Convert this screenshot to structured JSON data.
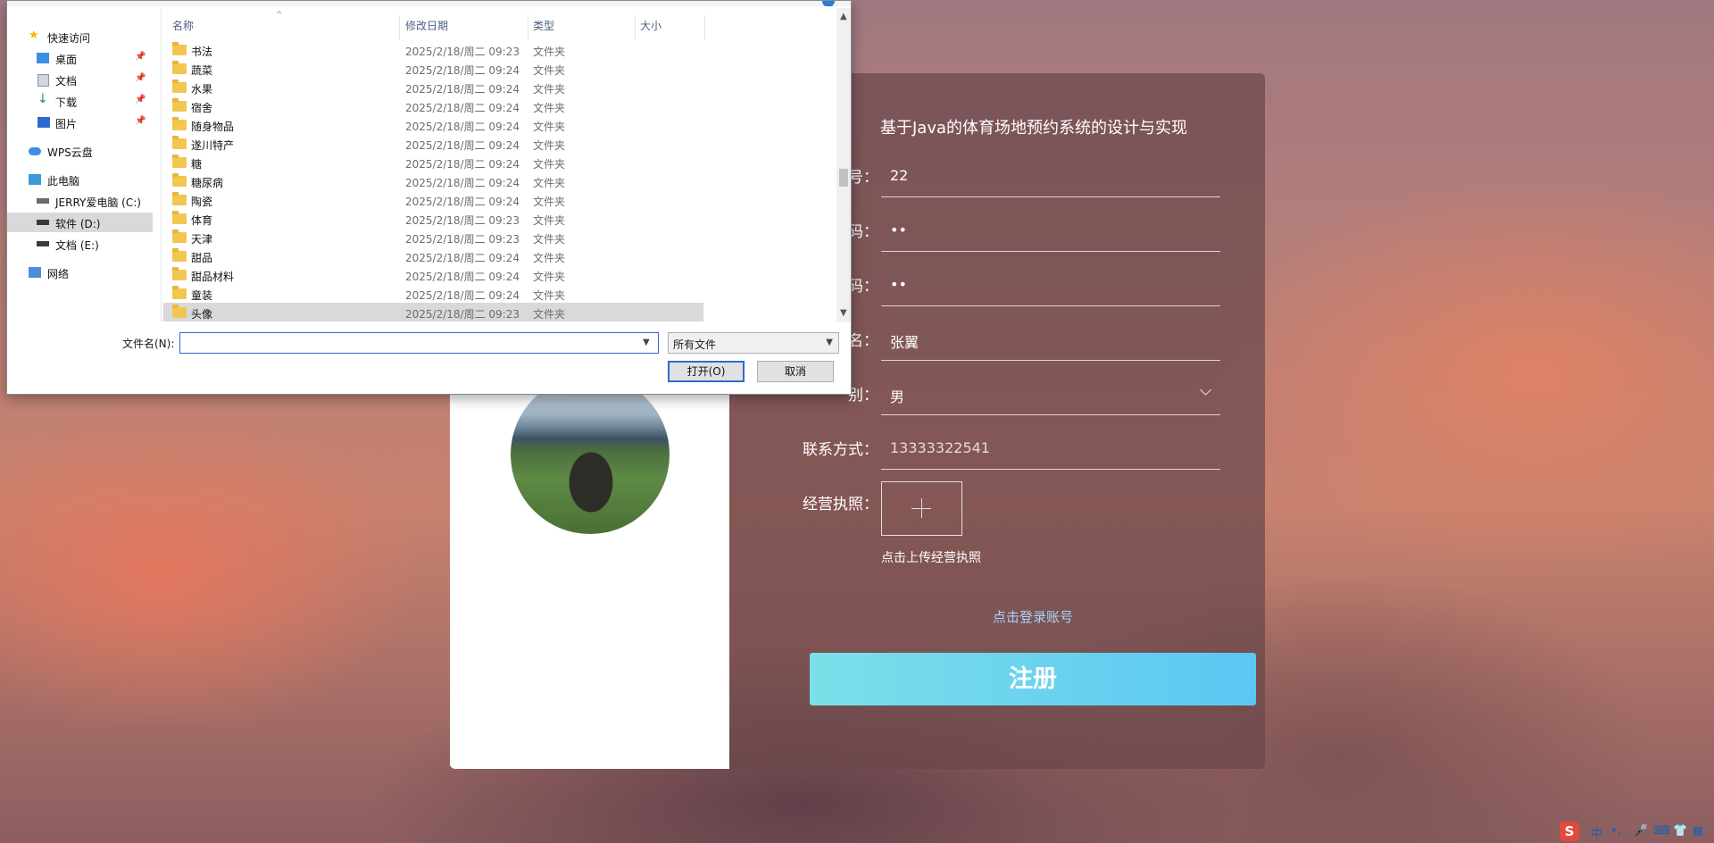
{
  "registration": {
    "title": "基于Java的体育场地预约系统的设计与实现",
    "fields": [
      {
        "label": "号：",
        "value": "22",
        "required": true
      },
      {
        "label": "码：",
        "value": "••",
        "required": true
      },
      {
        "label": "码：",
        "value": "••",
        "required": true
      },
      {
        "label": "名：",
        "value": "张翼",
        "required": true
      },
      {
        "label": "别：",
        "value": "男",
        "required": false
      },
      {
        "label": "联系方式：",
        "value": "13333322541",
        "required": false
      }
    ],
    "license_label": "经营执照：",
    "upload_hint": "点击上传经营执照",
    "login_link": "点击登录账号",
    "register_button": "注册"
  },
  "dialog": {
    "nav": [
      {
        "label": "快速访问",
        "icon": "star-icon"
      },
      {
        "label": "桌面",
        "icon": "desktop-icon",
        "pinned": true
      },
      {
        "label": "文档",
        "icon": "document-icon",
        "pinned": true
      },
      {
        "label": "下载",
        "icon": "download-icon",
        "pinned": true
      },
      {
        "label": "图片",
        "icon": "picture-icon",
        "pinned": true
      },
      {
        "label": "WPS云盘",
        "icon": "cloud-icon"
      },
      {
        "label": "此电脑",
        "icon": "computer-icon"
      },
      {
        "label": "JERRY爱电脑 (C:)",
        "icon": "drive-icon"
      },
      {
        "label": "软件 (D:)",
        "icon": "drive-icon",
        "selected": true
      },
      {
        "label": "文档 (E:)",
        "icon": "drive-icon"
      },
      {
        "label": "网络",
        "icon": "network-icon"
      }
    ],
    "columns": {
      "name": "名称",
      "date": "修改日期",
      "type": "类型",
      "size": "大小"
    },
    "files": [
      {
        "name": "书法",
        "date": "2025/2/18/周二 09:23",
        "type": "文件夹"
      },
      {
        "name": "蔬菜",
        "date": "2025/2/18/周二 09:24",
        "type": "文件夹"
      },
      {
        "name": "水果",
        "date": "2025/2/18/周二 09:24",
        "type": "文件夹"
      },
      {
        "name": "宿舍",
        "date": "2025/2/18/周二 09:24",
        "type": "文件夹"
      },
      {
        "name": "随身物品",
        "date": "2025/2/18/周二 09:24",
        "type": "文件夹"
      },
      {
        "name": "遂川特产",
        "date": "2025/2/18/周二 09:24",
        "type": "文件夹"
      },
      {
        "name": "糖",
        "date": "2025/2/18/周二 09:24",
        "type": "文件夹"
      },
      {
        "name": "糖尿病",
        "date": "2025/2/18/周二 09:24",
        "type": "文件夹"
      },
      {
        "name": "陶瓷",
        "date": "2025/2/18/周二 09:24",
        "type": "文件夹"
      },
      {
        "name": "体育",
        "date": "2025/2/18/周二 09:23",
        "type": "文件夹"
      },
      {
        "name": "天津",
        "date": "2025/2/18/周二 09:23",
        "type": "文件夹"
      },
      {
        "name": "甜品",
        "date": "2025/2/18/周二 09:24",
        "type": "文件夹"
      },
      {
        "name": "甜品材料",
        "date": "2025/2/18/周二 09:24",
        "type": "文件夹"
      },
      {
        "name": "童装",
        "date": "2025/2/18/周二 09:24",
        "type": "文件夹"
      },
      {
        "name": "头像",
        "date": "2025/2/18/周二 09:23",
        "type": "文件夹",
        "selected": true
      }
    ],
    "filename_label": "文件名(N):",
    "filename_value": "",
    "filetype_value": "所有文件",
    "open_button": "打开(O)",
    "cancel_button": "取消"
  },
  "tray": {
    "ime_logo": "S",
    "lang": "中",
    "punct": "•,",
    "items": [
      "mic-icon",
      "keyboard-icon",
      "shirt-icon",
      "grid-icon"
    ]
  }
}
